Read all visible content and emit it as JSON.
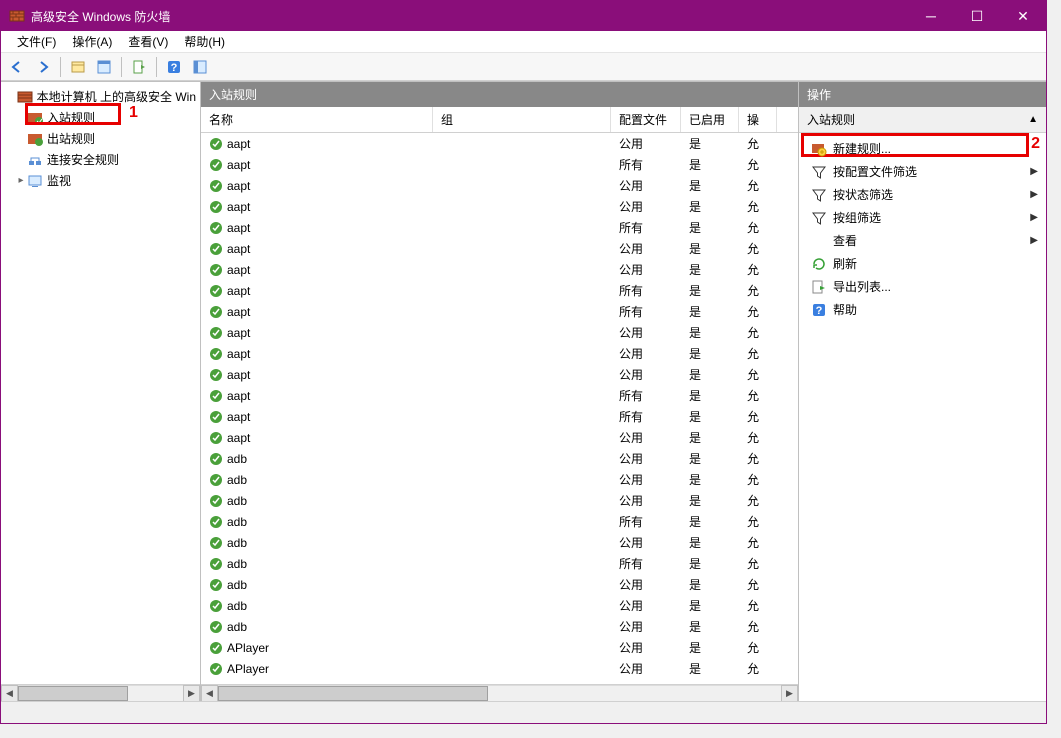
{
  "window": {
    "title": "高级安全 Windows 防火墙"
  },
  "menu": {
    "file": "文件(F)",
    "action": "操作(A)",
    "view": "查看(V)",
    "help": "帮助(H)"
  },
  "tree": {
    "root": "本地计算机 上的高级安全 Win",
    "items": [
      "入站规则",
      "出站规则",
      "连接安全规则",
      "监视"
    ]
  },
  "annotations": {
    "a1": "1",
    "a2": "2"
  },
  "list": {
    "title": "入站规则",
    "columns": {
      "name": "名称",
      "group": "组",
      "profile": "配置文件",
      "enabled": "已启用",
      "action": "操"
    },
    "rows": [
      {
        "name": "aapt",
        "group": "",
        "profile": "公用",
        "enabled": "是",
        "action": "允"
      },
      {
        "name": "aapt",
        "group": "",
        "profile": "所有",
        "enabled": "是",
        "action": "允"
      },
      {
        "name": "aapt",
        "group": "",
        "profile": "公用",
        "enabled": "是",
        "action": "允"
      },
      {
        "name": "aapt",
        "group": "",
        "profile": "公用",
        "enabled": "是",
        "action": "允"
      },
      {
        "name": "aapt",
        "group": "",
        "profile": "所有",
        "enabled": "是",
        "action": "允"
      },
      {
        "name": "aapt",
        "group": "",
        "profile": "公用",
        "enabled": "是",
        "action": "允"
      },
      {
        "name": "aapt",
        "group": "",
        "profile": "公用",
        "enabled": "是",
        "action": "允"
      },
      {
        "name": "aapt",
        "group": "",
        "profile": "所有",
        "enabled": "是",
        "action": "允"
      },
      {
        "name": "aapt",
        "group": "",
        "profile": "所有",
        "enabled": "是",
        "action": "允"
      },
      {
        "name": "aapt",
        "group": "",
        "profile": "公用",
        "enabled": "是",
        "action": "允"
      },
      {
        "name": "aapt",
        "group": "",
        "profile": "公用",
        "enabled": "是",
        "action": "允"
      },
      {
        "name": "aapt",
        "group": "",
        "profile": "公用",
        "enabled": "是",
        "action": "允"
      },
      {
        "name": "aapt",
        "group": "",
        "profile": "所有",
        "enabled": "是",
        "action": "允"
      },
      {
        "name": "aapt",
        "group": "",
        "profile": "所有",
        "enabled": "是",
        "action": "允"
      },
      {
        "name": "aapt",
        "group": "",
        "profile": "公用",
        "enabled": "是",
        "action": "允"
      },
      {
        "name": "adb",
        "group": "",
        "profile": "公用",
        "enabled": "是",
        "action": "允"
      },
      {
        "name": "adb",
        "group": "",
        "profile": "公用",
        "enabled": "是",
        "action": "允"
      },
      {
        "name": "adb",
        "group": "",
        "profile": "公用",
        "enabled": "是",
        "action": "允"
      },
      {
        "name": "adb",
        "group": "",
        "profile": "所有",
        "enabled": "是",
        "action": "允"
      },
      {
        "name": "adb",
        "group": "",
        "profile": "公用",
        "enabled": "是",
        "action": "允"
      },
      {
        "name": "adb",
        "group": "",
        "profile": "所有",
        "enabled": "是",
        "action": "允"
      },
      {
        "name": "adb",
        "group": "",
        "profile": "公用",
        "enabled": "是",
        "action": "允"
      },
      {
        "name": "adb",
        "group": "",
        "profile": "公用",
        "enabled": "是",
        "action": "允"
      },
      {
        "name": "adb",
        "group": "",
        "profile": "公用",
        "enabled": "是",
        "action": "允"
      },
      {
        "name": "APlayer",
        "group": "",
        "profile": "公用",
        "enabled": "是",
        "action": "允"
      },
      {
        "name": "APlayer",
        "group": "",
        "profile": "公用",
        "enabled": "是",
        "action": "允"
      }
    ]
  },
  "actions": {
    "title": "操作",
    "section": "入站规则",
    "items": [
      {
        "label": "新建规则...",
        "icon": "new-rule"
      },
      {
        "label": "按配置文件筛选",
        "icon": "filter",
        "submenu": true
      },
      {
        "label": "按状态筛选",
        "icon": "filter",
        "submenu": true
      },
      {
        "label": "按组筛选",
        "icon": "filter",
        "submenu": true
      },
      {
        "label": "查看",
        "icon": "none",
        "submenu": true
      },
      {
        "label": "刷新",
        "icon": "refresh"
      },
      {
        "label": "导出列表...",
        "icon": "export"
      },
      {
        "label": "帮助",
        "icon": "help"
      }
    ]
  }
}
